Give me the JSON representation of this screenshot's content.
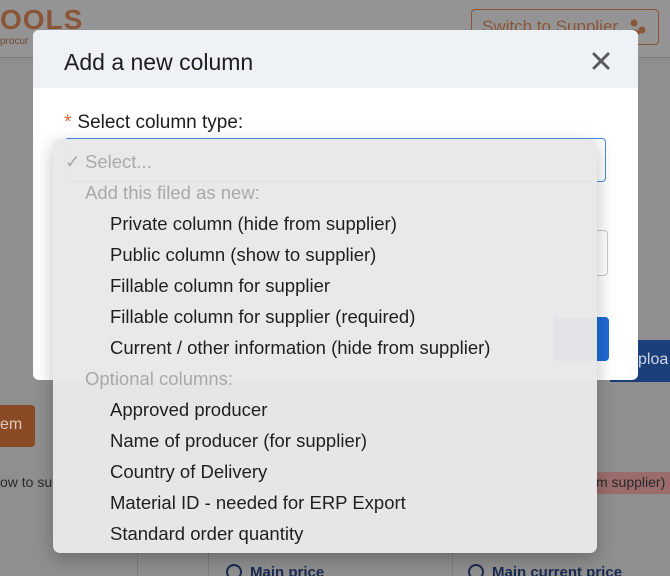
{
  "background": {
    "logo_text": "OOLS",
    "logo_sub": "procur",
    "switch_button_label": "Switch to Supplier",
    "upload_label": "ploa",
    "item_button_label": "em",
    "left_snippet": "ow to su",
    "right_snippet": "m supplier)",
    "radio_1_label": "Main price",
    "radio_2_label": "Main current price"
  },
  "modal": {
    "title": "Add a new column",
    "close_icon": "close-icon",
    "required_mark": "*",
    "field_label": "Select column type:"
  },
  "dropdown": {
    "selected": {
      "check": "✓",
      "label": "Select..."
    },
    "groups": [
      {
        "label": "Add this filed as new:",
        "options": [
          "Private column (hide from supplier)",
          "Public column (show to supplier)",
          "Fillable column for supplier",
          "Fillable column for supplier (required)",
          "Current / other information (hide from supplier)"
        ]
      },
      {
        "label": "Optional columns:",
        "options": [
          "Approved producer",
          "Name of producer (for supplier)",
          "Country of Delivery",
          "Material ID - needed for ERP Export",
          "Standard order quantity"
        ]
      }
    ]
  },
  "colors": {
    "accent_blue": "#4a8be8",
    "required_orange": "#e0673a",
    "brand_brown": "#8a5538"
  }
}
